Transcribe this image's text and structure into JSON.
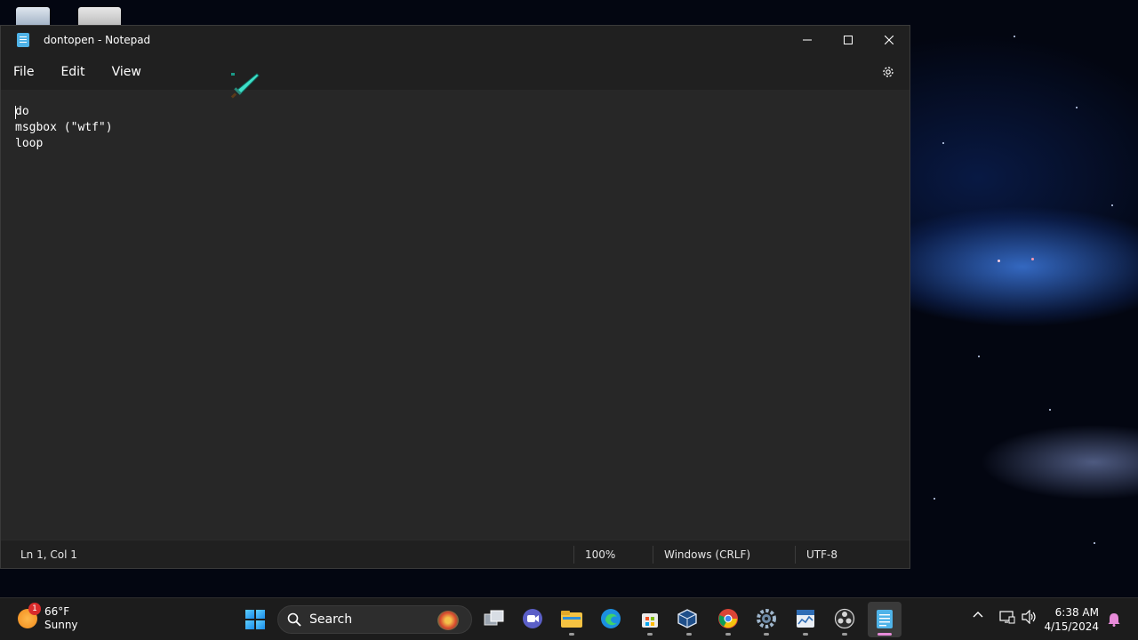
{
  "window": {
    "title": "dontopen - Notepad",
    "controls": {
      "minimize": "—",
      "maximize": "☐",
      "close": "✕"
    }
  },
  "menu": {
    "items": [
      {
        "label": "File"
      },
      {
        "label": "Edit"
      },
      {
        "label": "View"
      }
    ],
    "settings_icon": "gear-icon"
  },
  "editor": {
    "lines": [
      "do",
      "msgbox (\"wtf\")",
      "loop"
    ]
  },
  "status": {
    "position": "Ln 1, Col 1",
    "zoom": "100%",
    "line_ending": "Windows (CRLF)",
    "encoding": "UTF-8"
  },
  "taskbar": {
    "weather": {
      "temp": "66°F",
      "condition": "Sunny",
      "badge": "1"
    },
    "search": {
      "placeholder": "Search"
    },
    "apps": [
      "task-view",
      "teams-meet",
      "file-explorer",
      "edge",
      "microsoft-store",
      "virtualbox",
      "chrome",
      "settings",
      "task-manager",
      "obs",
      "notepad"
    ],
    "tray": {
      "chevron": "^"
    },
    "clock": {
      "time": "6:38 AM",
      "date": "4/15/2024"
    }
  },
  "colors": {
    "window_bg": "#272727",
    "titlebar_bg": "#202020",
    "taskbar_bg": "#1c1c1c",
    "accent": "#4fb3e8"
  }
}
